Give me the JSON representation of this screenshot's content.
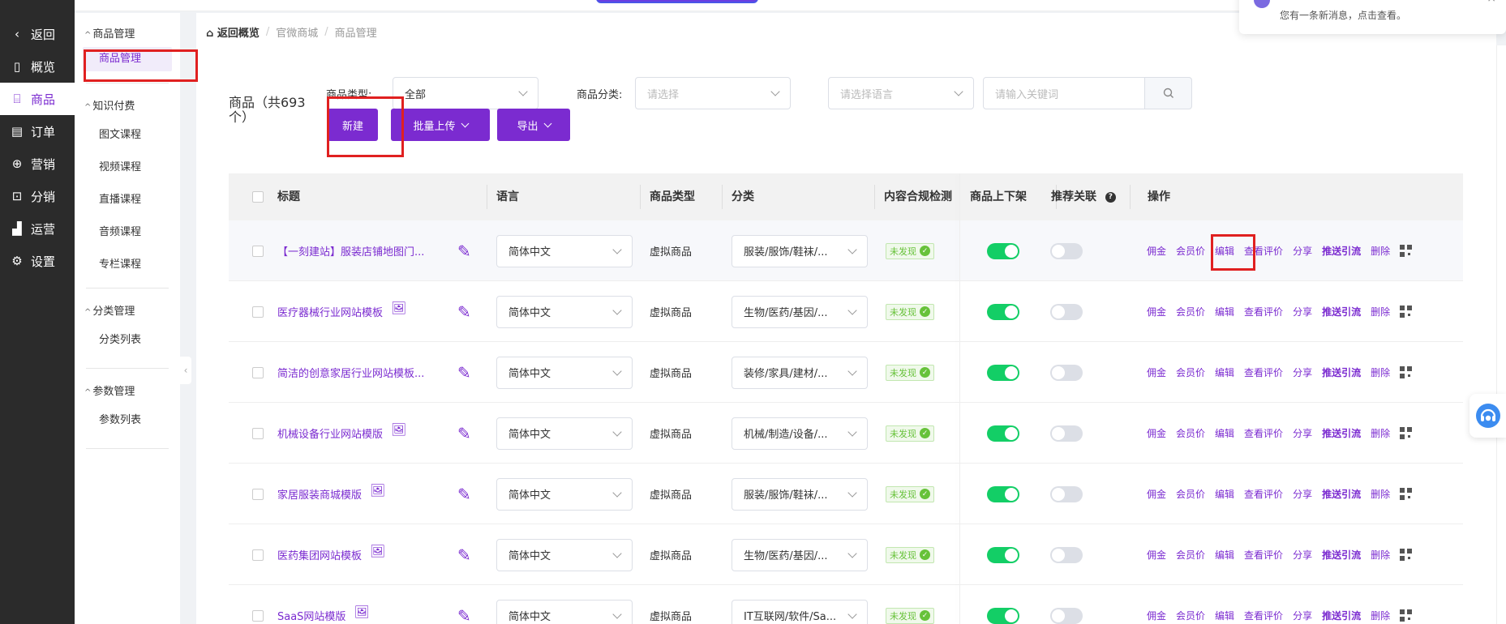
{
  "sidebar": {
    "items": [
      {
        "icon": "chevron-left-icon",
        "glyph": "‹",
        "label": "返回"
      },
      {
        "icon": "overview-icon",
        "glyph": "▯",
        "label": "概览"
      },
      {
        "icon": "product-icon",
        "glyph": "⌸",
        "label": "商品"
      },
      {
        "icon": "order-icon",
        "glyph": "▤",
        "label": "订单"
      },
      {
        "icon": "marketing-icon",
        "glyph": "⊕",
        "label": "营销"
      },
      {
        "icon": "distribution-icon",
        "glyph": "⊡",
        "label": "分销"
      },
      {
        "icon": "operations-icon",
        "glyph": "▟",
        "label": "运营"
      },
      {
        "icon": "settings-icon",
        "glyph": "⚙",
        "label": "设置"
      }
    ]
  },
  "submenu": {
    "group1": "商品管理",
    "item_product": "商品管理",
    "group2": "知识付费",
    "knowledge": [
      "图文课程",
      "视频课程",
      "直播课程",
      "音频课程",
      "专栏课程"
    ],
    "group3": "分类管理",
    "category_list": "分类列表",
    "group4": "参数管理",
    "param_list": "参数列表"
  },
  "breadcrumb": {
    "home": "返回概览",
    "mall": "官微商城",
    "current": "商品管理"
  },
  "notification": {
    "text": "您有一条新消息，点击查看。"
  },
  "toolbar": {
    "count_label": "商品（共693个）",
    "type_label": "商品类型:",
    "type_value": "全部",
    "category_label": "商品分类:",
    "category_placeholder": "请选择",
    "language_placeholder": "请选择语言",
    "keyword_placeholder": "请输入关键词",
    "new_label": "新建",
    "batch_label": "批量上传",
    "export_label": "导出"
  },
  "table": {
    "headers": {
      "title": "标题",
      "language": "语言",
      "type": "商品类型",
      "category": "分类",
      "compliance": "内容合规检测",
      "shelf": "商品上下架",
      "recommend": "推荐关联",
      "actions": "操作"
    },
    "action_labels": {
      "commission": "佣金",
      "member_price": "会员价",
      "edit": "编辑",
      "reviews": "查看评价",
      "share": "分享",
      "promote": "推送引流",
      "delete": "删除"
    },
    "rows": [
      {
        "title": "【一刻建站】服装店铺地图门...",
        "has_image_icon": false,
        "language": "简体中文",
        "type": "虚拟商品",
        "category": "服装/服饰/鞋袜/...",
        "compliance": "未发现",
        "on_shelf": true,
        "recommend": false
      },
      {
        "title": "医疗器械行业网站模板",
        "has_image_icon": true,
        "language": "简体中文",
        "type": "虚拟商品",
        "category": "生物/医药/基因/...",
        "compliance": "未发现",
        "on_shelf": true,
        "recommend": false
      },
      {
        "title": "简洁的创意家居行业网站模板...",
        "has_image_icon": false,
        "language": "简体中文",
        "type": "虚拟商品",
        "category": "装修/家具/建材/...",
        "compliance": "未发现",
        "on_shelf": true,
        "recommend": false
      },
      {
        "title": "机械设备行业网站模版",
        "has_image_icon": true,
        "language": "简体中文",
        "type": "虚拟商品",
        "category": "机械/制造/设备/...",
        "compliance": "未发现",
        "on_shelf": true,
        "recommend": false
      },
      {
        "title": "家居服装商城模版",
        "has_image_icon": true,
        "language": "简体中文",
        "type": "虚拟商品",
        "category": "服装/服饰/鞋袜/...",
        "compliance": "未发现",
        "on_shelf": true,
        "recommend": false
      },
      {
        "title": "医药集团网站模板",
        "has_image_icon": true,
        "language": "简体中文",
        "type": "虚拟商品",
        "category": "生物/医药/基因/...",
        "compliance": "未发现",
        "on_shelf": true,
        "recommend": false
      },
      {
        "title": "SaaS网站模版",
        "has_image_icon": true,
        "language": "简体中文",
        "type": "虚拟商品",
        "category": "IT互联网/软件/Sa...",
        "compliance": "未发现",
        "on_shelf": true,
        "recommend": false
      }
    ]
  },
  "colors": {
    "accent": "#7b2bd0",
    "sidebar_bg": "#2b2b2b",
    "switch_on": "#13ce66",
    "annotation": "#e02020"
  }
}
